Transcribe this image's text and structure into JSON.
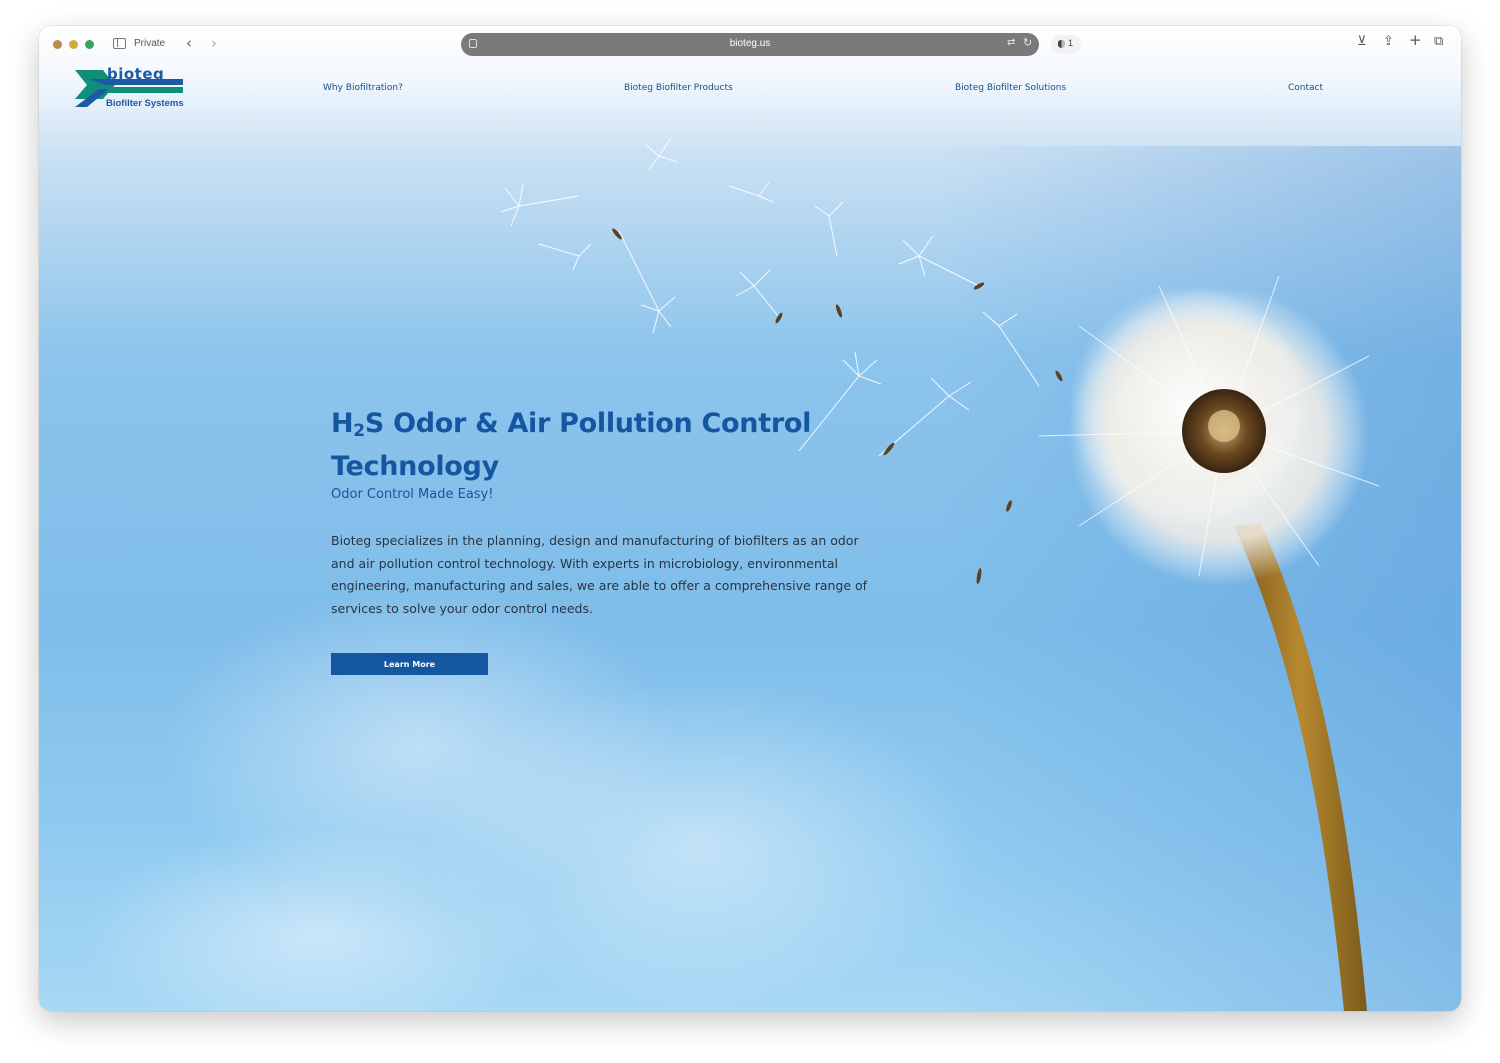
{
  "browser": {
    "private_label": "Private",
    "url": "bioteg.us",
    "tracker_count": "1"
  },
  "site": {
    "logo": {
      "wordmark": "bioteg",
      "tagline": "Biofilter Systems"
    },
    "nav": [
      {
        "label": "Why Biofiltration?"
      },
      {
        "label": "Bioteg Biofilter Products"
      },
      {
        "label": "Bioteg Biofilter Solutions"
      },
      {
        "label": "Contact"
      }
    ]
  },
  "hero": {
    "title_prefix": "H",
    "title_sub": "2",
    "title_rest": "S Odor & Air Pollution Control Technology",
    "subtitle": "Odor Control Made Easy!",
    "body": "Bioteg specializes in the planning, design and manufacturing of biofilters as an odor and air pollution control technology. With experts in microbiology, environmental engineering, manufacturing and sales, we are able to offer a comprehensive range of services to solve your odor control needs.",
    "cta_label": "Learn More"
  },
  "colors": {
    "brand_blue": "#1556a0",
    "logo_teal": "#0f8f7a",
    "sky_blue": "#8cc4ec"
  },
  "icons": [
    "sidebar-icon",
    "back-icon",
    "forward-icon",
    "page-icon",
    "translate-icon",
    "reload-icon",
    "privacy-shield-icon",
    "download-icon",
    "share-icon",
    "new-tab-icon",
    "tab-overview-icon"
  ]
}
